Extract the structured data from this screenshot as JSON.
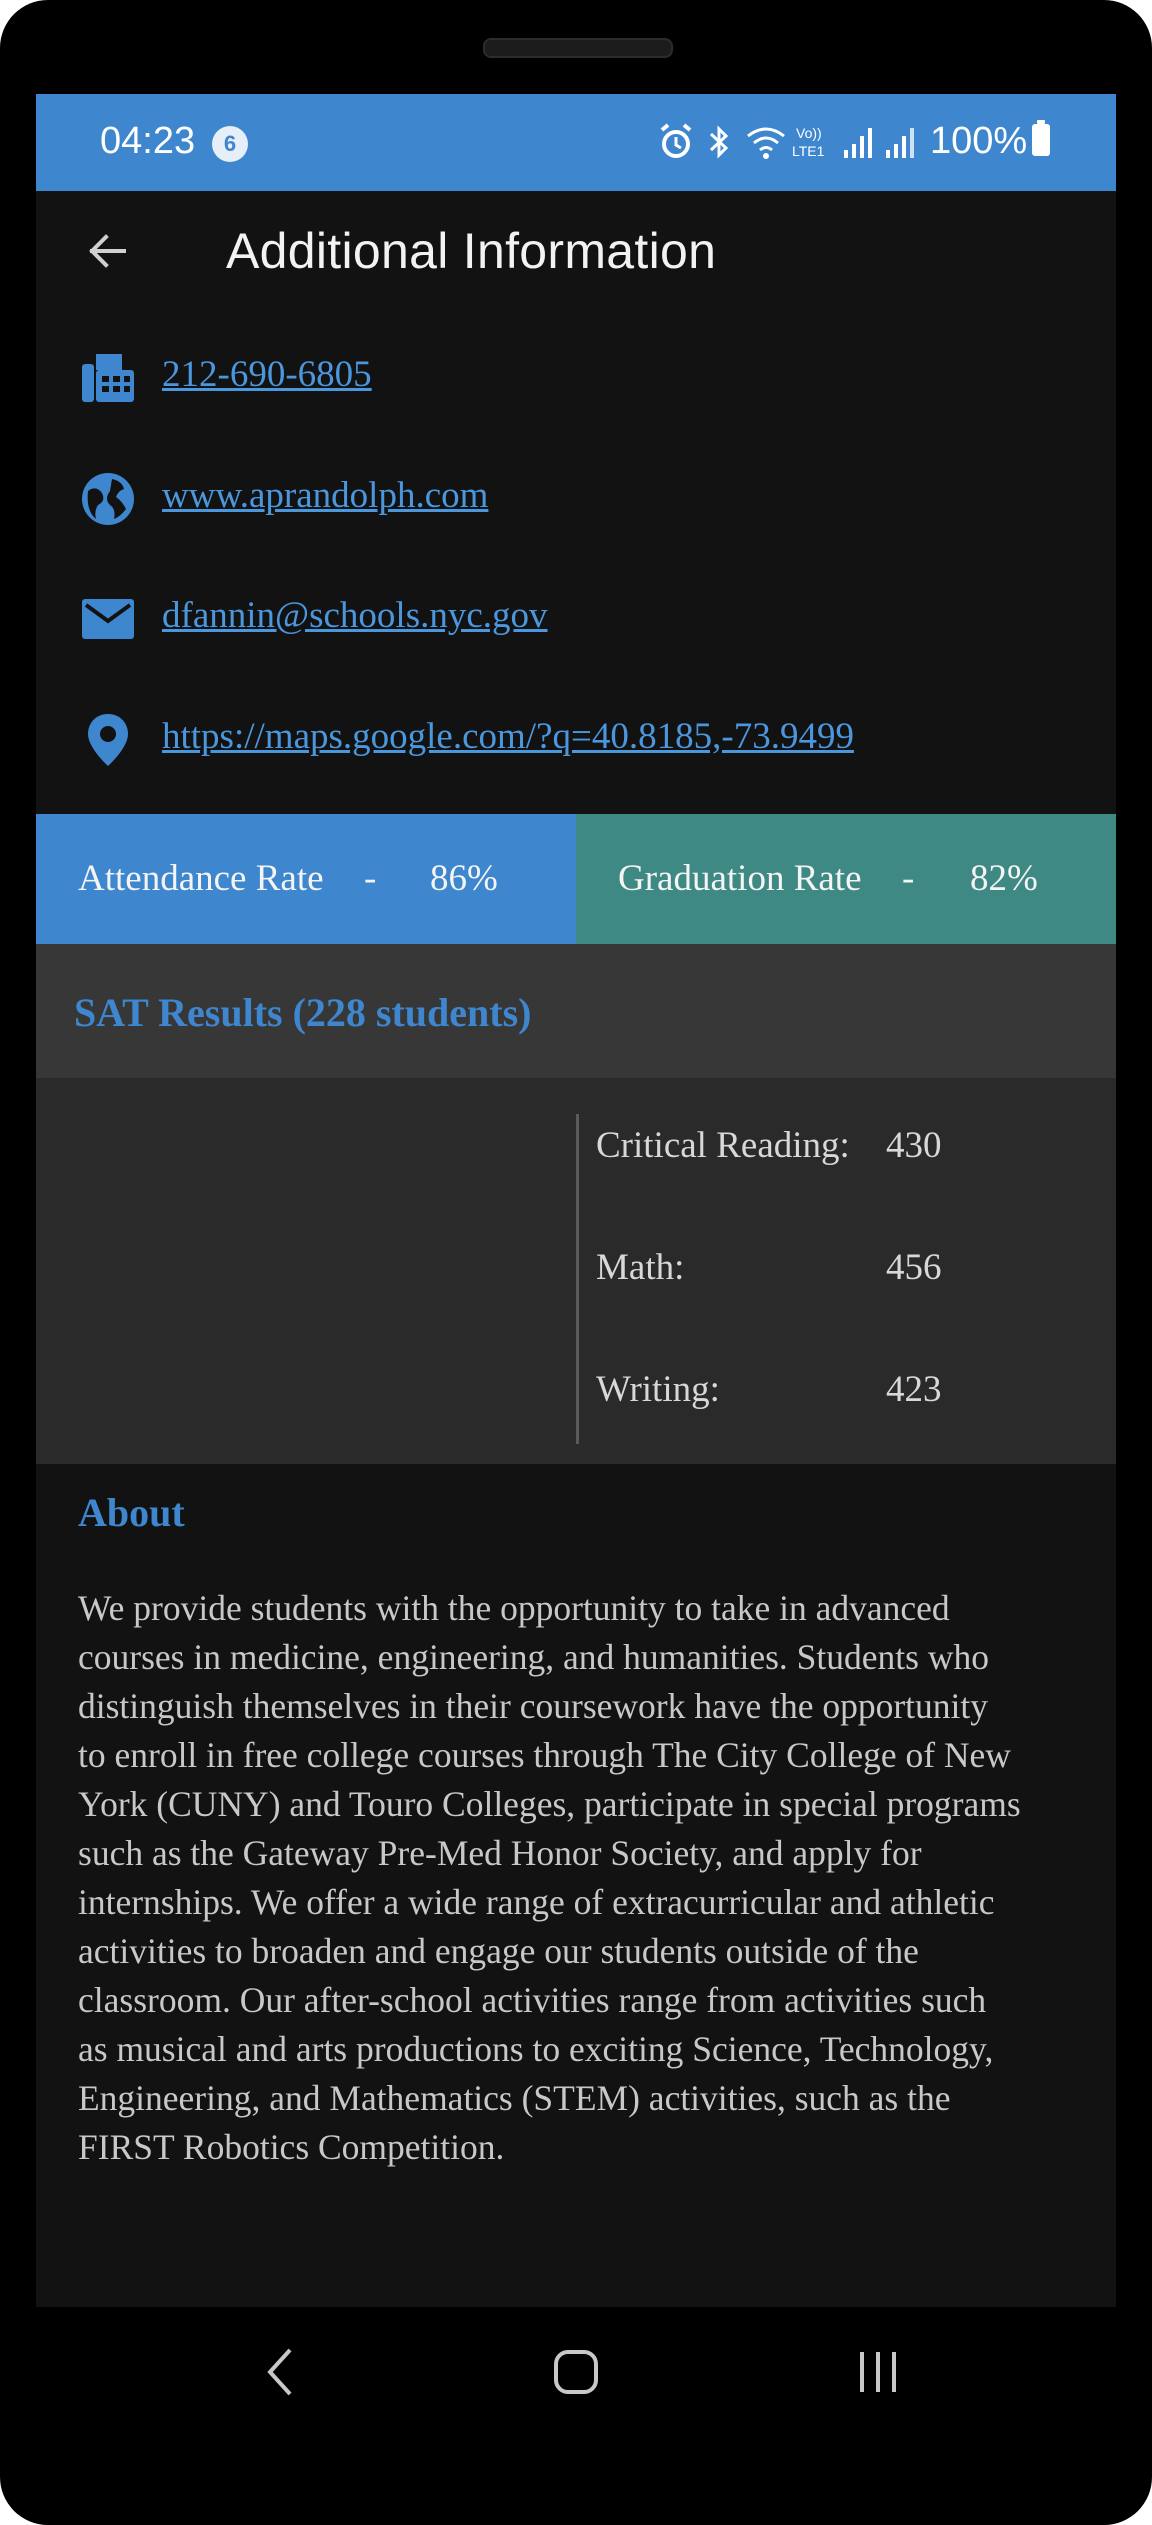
{
  "status_bar": {
    "time": "04:23",
    "notification_count": "6",
    "battery": "100%",
    "icons": [
      "alarm-icon",
      "bluetooth-icon",
      "wifi-calling-icon",
      "volte-icon",
      "signal-icon",
      "signal-icon",
      "battery-icon"
    ]
  },
  "app_bar": {
    "title": "Additional Information",
    "back_icon": "arrow-back-icon"
  },
  "contacts": {
    "phone": "212-690-6805",
    "website": "www.aprandolph.com",
    "email": "dfannin@schools.nyc.gov",
    "map": "https://maps.google.com/?q=40.8185,-73.9499"
  },
  "rates": {
    "attendance_label": "Attendance Rate",
    "attendance_sep": "-",
    "attendance_value": "86%",
    "graduation_label": "Graduation Rate",
    "graduation_sep": "-",
    "graduation_value": "82%"
  },
  "sat": {
    "title": "SAT Results (228 students)",
    "rows": [
      {
        "label": "Critical Reading:",
        "value": "430"
      },
      {
        "label": "Math:",
        "value": "456"
      },
      {
        "label": "Writing:",
        "value": "423"
      }
    ]
  },
  "about": {
    "title": "About",
    "text": "We provide students with the opportunity to take in advanced\ncourses in medicine, engineering, and humanities. Students who\ndistinguish themselves in their coursework have the opportunity\nto enroll in free college courses through The City College of New\nYork (CUNY) and Touro Colleges, participate in special programs\nsuch as the Gateway Pre-Med Honor Society, and apply for\ninternships. We offer a wide range of extracurricular and athletic\nactivities to broaden and engage our students outside of the\nclassroom. Our after-school activities range from activities such\nas musical and arts productions to exciting Science, Technology,\nEngineering, and Mathematics (STEM) activities, such as the\nFIRST Robotics Competition."
  },
  "colors": {
    "accent": "#3e86cd",
    "teal": "#3f8985",
    "link": "#4b97de",
    "background": "#121212"
  }
}
